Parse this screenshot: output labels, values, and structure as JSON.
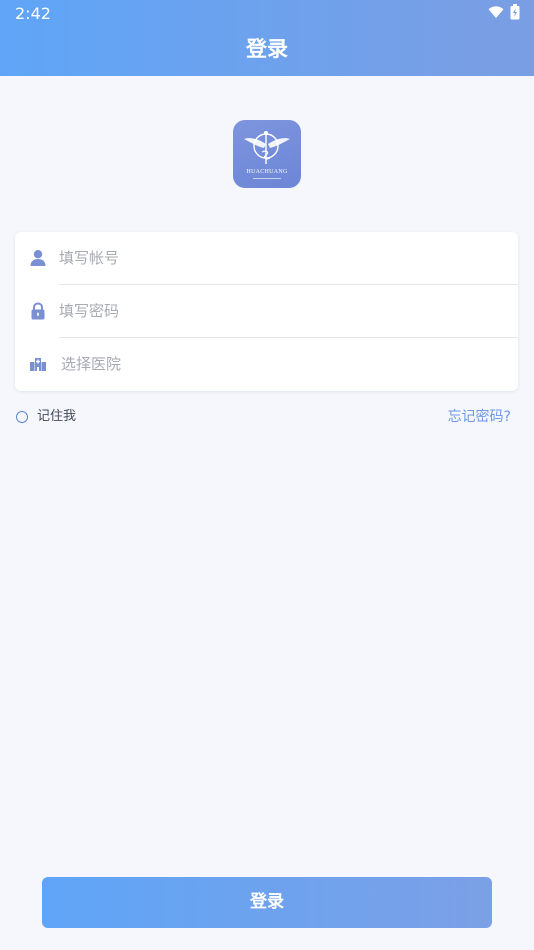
{
  "status_bar": {
    "time": "2:42",
    "wifi_icon": "wifi-icon",
    "battery_icon": "battery-charging-icon"
  },
  "header": {
    "title": "登录"
  },
  "logo": {
    "icon": "winged-caduceus-logo",
    "brand_text": "HUACHUANG",
    "background_color": "#7790dc"
  },
  "form": {
    "account": {
      "icon": "user-icon",
      "placeholder": "填写帐号"
    },
    "password": {
      "icon": "lock-icon",
      "placeholder": "填写密码"
    },
    "hospital": {
      "icon": "hospital-building-icon",
      "placeholder": "选择医院"
    }
  },
  "options": {
    "remember_label": "记住我",
    "forgot_label": "忘记密码?"
  },
  "actions": {
    "login_label": "登录"
  },
  "colors": {
    "accent": "#5fa5f7",
    "accent_end": "#7b9ee3",
    "link": "#6b98e3",
    "icon": "#7b8fd3",
    "page_background": "#f5f7fc"
  }
}
